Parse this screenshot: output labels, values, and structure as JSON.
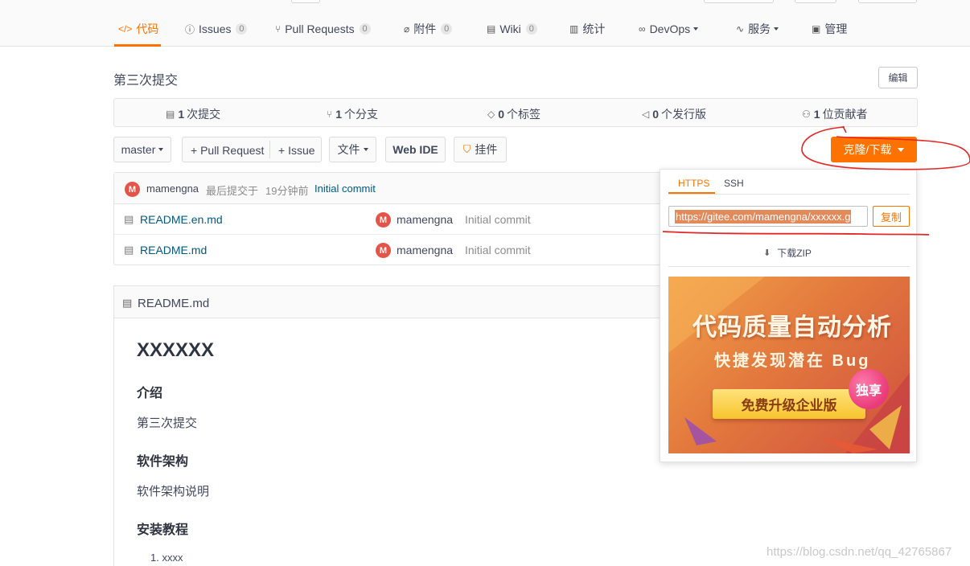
{
  "nav": {
    "tabs": [
      {
        "label": "代码",
        "icon": "code-icon",
        "badge": ""
      },
      {
        "label": "Issues",
        "icon": "issue-icon",
        "badge": "0"
      },
      {
        "label": "Pull Requests",
        "icon": "pull-request-icon",
        "badge": "0"
      },
      {
        "label": "附件",
        "icon": "attachment-icon",
        "badge": "0"
      },
      {
        "label": "Wiki",
        "icon": "wiki-icon",
        "badge": "0"
      },
      {
        "label": "统计",
        "icon": "chart-icon",
        "badge": ""
      },
      {
        "label": "DevOps",
        "icon": "devops-icon",
        "badge": ""
      },
      {
        "label": "服务",
        "icon": "service-icon",
        "badge": ""
      },
      {
        "label": "管理",
        "icon": "manage-icon",
        "badge": ""
      }
    ],
    "accent_color": "#fe7300"
  },
  "repo": {
    "description": "第三次提交",
    "edit_label": "编辑"
  },
  "stats": [
    {
      "count": "1",
      "label": "次提交",
      "icon": "commit-icon"
    },
    {
      "count": "1",
      "label": "个分支",
      "icon": "branch-icon"
    },
    {
      "count": "0",
      "label": "个标签",
      "icon": "tag-icon"
    },
    {
      "count": "0",
      "label": "个发行版",
      "icon": "release-icon"
    },
    {
      "count": "1",
      "label": "位贡献者",
      "icon": "contributors-icon"
    }
  ],
  "toolbar": {
    "branch": "master",
    "pull_request": "+ Pull Request",
    "issue": "+ Issue",
    "file": "文件",
    "webide": "Web IDE",
    "widget": "挂件",
    "clone": "克隆/下载"
  },
  "files": {
    "last_commit": {
      "avatar": "M",
      "user": "mamengna",
      "text": "最后提交于",
      "time": "19分钟前",
      "message": "Initial commit"
    },
    "rows": [
      {
        "name": "README.en.md",
        "avatar": "M",
        "user": "mamengna",
        "message": "Initial commit"
      },
      {
        "name": "README.md",
        "avatar": "M",
        "user": "mamengna",
        "message": "Initial commit"
      }
    ]
  },
  "readme": {
    "file": "README.md",
    "title": "XXXXXX",
    "sections": [
      {
        "heading": "介绍",
        "text": "第三次提交"
      },
      {
        "heading": "软件架构",
        "text": "软件架构说明"
      },
      {
        "heading": "安装教程",
        "text": ""
      }
    ],
    "list_item": "1. xxxx"
  },
  "clone_panel": {
    "tabs": [
      "HTTPS",
      "SSH"
    ],
    "url": "https://gitee.com/mamengna/xxxxxx.g",
    "copy_label": "复制",
    "zip_label": "下载ZIP",
    "banner": {
      "title": "代码质量自动分析",
      "subtitle": "快捷发现潜在 Bug",
      "cta": "免费升级企业版",
      "badge": "独享"
    }
  },
  "watermark": "https://blog.csdn.net/qq_42765867"
}
